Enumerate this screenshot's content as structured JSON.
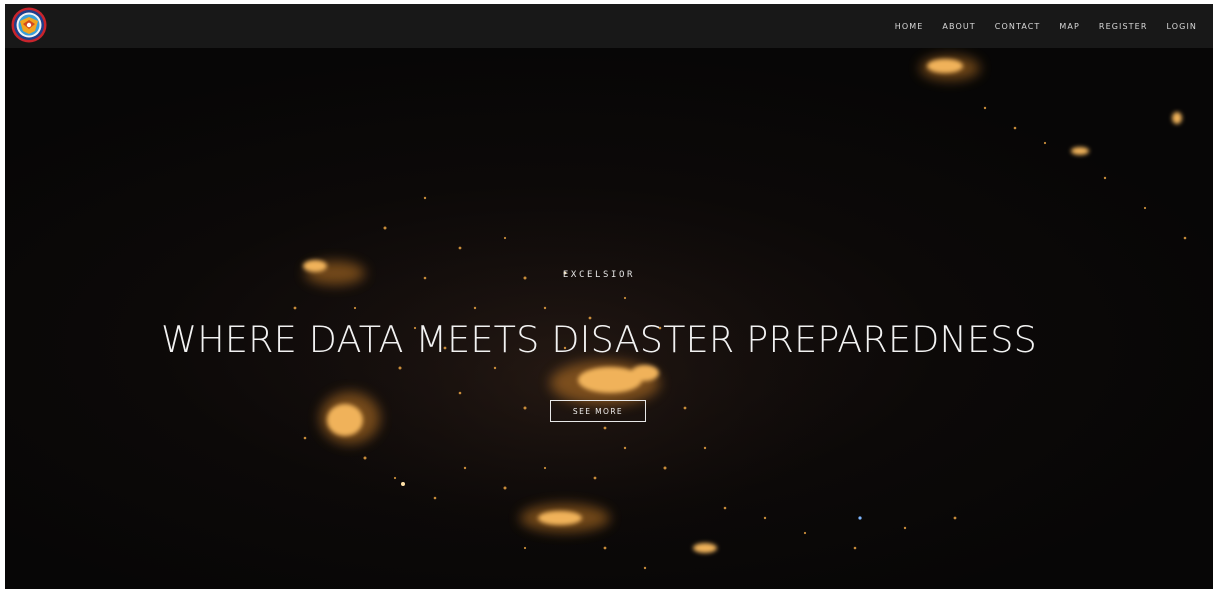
{
  "nav": {
    "logo_icon": "organization-seal-logo",
    "links": [
      "HOME",
      "ABOUT",
      "CONTACT",
      "MAP",
      "REGISTER",
      "LOGIN"
    ]
  },
  "hero": {
    "background": "night-satellite-city-lights",
    "eyebrow": "EXCELSIOR",
    "headline": "WHERE DATA MEETS DISASTER PREPAREDNESS",
    "cta_label": "SEE MORE"
  },
  "colors": {
    "navbar": "#181818",
    "background": "#0a0808",
    "lights": "#e9a343",
    "text": "#f2f2f2"
  }
}
